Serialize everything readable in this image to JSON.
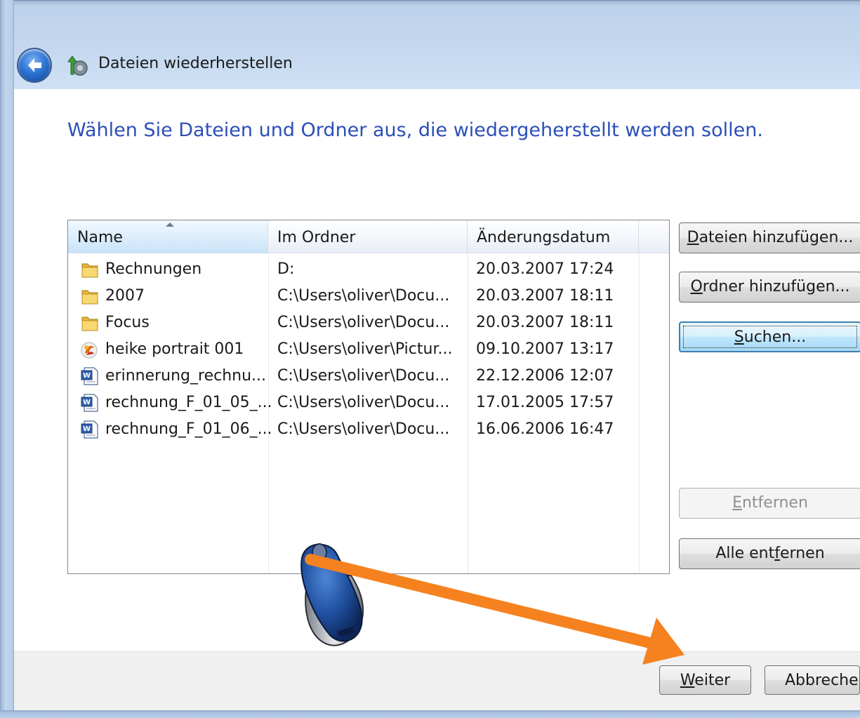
{
  "window": {
    "title": "Dateien wiederherstellen"
  },
  "instruction": "Wählen Sie Dateien und Ordner aus, die wiedergeherstellt werden sollen.",
  "list": {
    "columns": [
      "Name",
      "Im Ordner",
      "Änderungsdatum"
    ],
    "sorted_column": "Name",
    "rows": [
      {
        "icon": "folder-icon",
        "name": "Rechnungen",
        "folder": "D:",
        "date": "20.03.2007 17:24"
      },
      {
        "icon": "folder-icon",
        "name": "2007",
        "folder": "C:\\Users\\oliver\\Docu...",
        "date": "20.03.2007 18:11"
      },
      {
        "icon": "folder-icon",
        "name": "Focus",
        "folder": "C:\\Users\\oliver\\Docu...",
        "date": "20.03.2007 18:11"
      },
      {
        "icon": "image-file-icon",
        "name": "heike portrait 001",
        "folder": "C:\\Users\\oliver\\Pictur...",
        "date": "09.10.2007 13:17"
      },
      {
        "icon": "word-document-icon",
        "name": "erinnerung_rechnu...",
        "folder": "C:\\Users\\oliver\\Docu...",
        "date": "22.12.2006 12:07"
      },
      {
        "icon": "word-document-icon",
        "name": "rechnung_F_01_05_...",
        "folder": "C:\\Users\\oliver\\Docu...",
        "date": "17.01.2005 17:57"
      },
      {
        "icon": "word-document-icon",
        "name": "rechnung_F_01_06_...",
        "folder": "C:\\Users\\oliver\\Docu...",
        "date": "16.06.2006 16:47"
      }
    ]
  },
  "side_buttons": {
    "add_files": {
      "prefix": "",
      "accel": "D",
      "rest": "ateien hinzufügen..."
    },
    "add_folder": {
      "prefix": "",
      "accel": "O",
      "rest": "rdner hinzufügen..."
    },
    "search": {
      "prefix": "",
      "accel": "S",
      "rest": "uchen..."
    },
    "remove": {
      "prefix": "",
      "accel": "E",
      "rest": "ntfernen"
    },
    "remove_all": {
      "prefix": "Alle ent",
      "accel": "f",
      "rest": "ernen"
    }
  },
  "footer": {
    "next": {
      "accel": "W",
      "rest": "eiter"
    },
    "cancel": "Abbrechen"
  },
  "colors": {
    "instruction_text": "#2b4fb8",
    "header_band": "#c6d9f0",
    "pointer_arrow": "#f5821f"
  }
}
